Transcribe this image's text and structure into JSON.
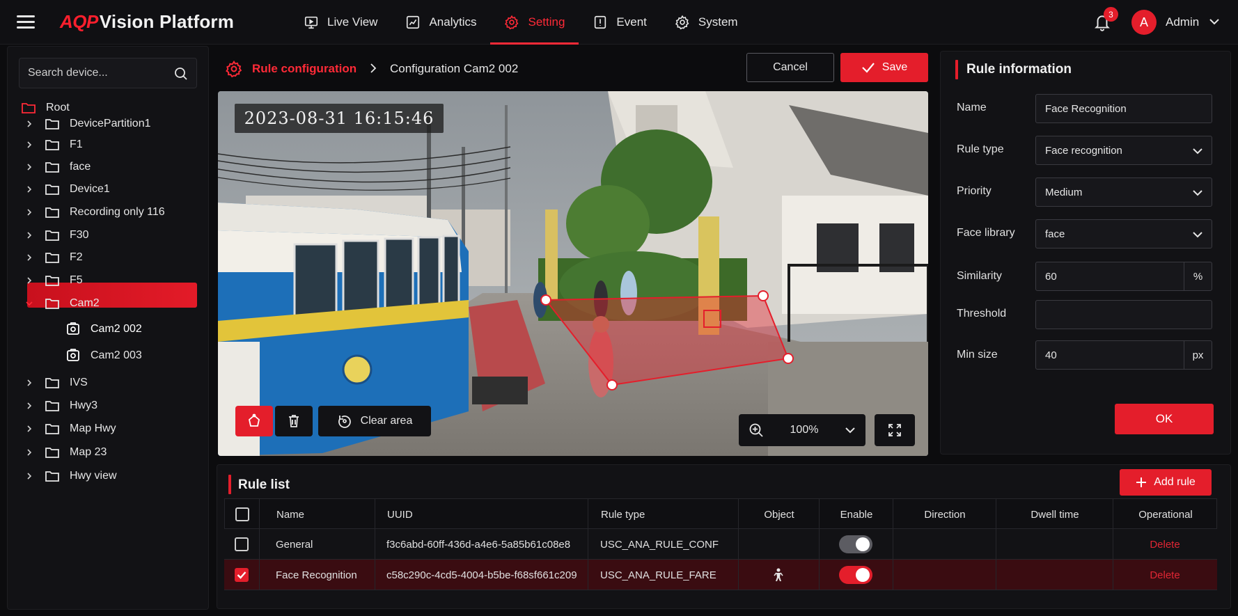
{
  "app": {
    "brand_part1": "AQP",
    "brand_part2": "Vision Platform"
  },
  "nav": [
    {
      "label": "Live View",
      "icon": "monitor-icon"
    },
    {
      "label": "Analytics",
      "icon": "analytics-icon"
    },
    {
      "label": "Setting",
      "icon": "gear-icon",
      "active": true
    },
    {
      "label": "Event",
      "icon": "event-icon"
    },
    {
      "label": "System",
      "icon": "system-gear-icon"
    }
  ],
  "header": {
    "notification_count": "3",
    "avatar_initial": "A",
    "user_name": "Admin"
  },
  "sidebar": {
    "search_placeholder": "Search device...",
    "root_label": "Root",
    "items": [
      {
        "label": "DevicePartition1",
        "type": "folder"
      },
      {
        "label": "F1",
        "type": "folder"
      },
      {
        "label": "face",
        "type": "folder"
      },
      {
        "label": "Device1",
        "type": "folder"
      },
      {
        "label": "Recording only 116",
        "type": "folder"
      },
      {
        "label": "F30",
        "type": "folder"
      },
      {
        "label": "F2",
        "type": "folder"
      },
      {
        "label": "F5",
        "type": "folder"
      },
      {
        "label": "Cam2",
        "type": "folder",
        "expanded": true
      },
      {
        "label": "Cam2 002",
        "type": "camera",
        "selected": true
      },
      {
        "label": "Cam2 003",
        "type": "camera"
      },
      {
        "label": "IVS",
        "type": "folder"
      },
      {
        "label": "Hwy3",
        "type": "folder"
      },
      {
        "label": "Map Hwy",
        "type": "folder"
      },
      {
        "label": "Map 23",
        "type": "folder"
      },
      {
        "label": "Hwy view",
        "type": "folder"
      }
    ]
  },
  "breadcrumb": {
    "title": "Rule configuration",
    "current": "Configuration Cam2 002"
  },
  "actions": {
    "cancel": "Cancel",
    "save": "Save"
  },
  "video": {
    "timestamp": "2023-08-31  16:15:46",
    "clear_area": "Clear area",
    "zoom": "100%"
  },
  "rule_info": {
    "title": "Rule information",
    "fields": {
      "name": {
        "label": "Name",
        "value": "Face Recognition"
      },
      "rule_type": {
        "label": "Rule type",
        "value": "Face recognition"
      },
      "priority": {
        "label": "Priority",
        "value": "Medium"
      },
      "face_library": {
        "label": "Face library",
        "value": "face"
      },
      "similarity": {
        "label": "Similarity",
        "value": "60",
        "unit": "%"
      },
      "threshold": {
        "label": "Threshold",
        "value": ""
      },
      "min_size": {
        "label": "Min size",
        "value": "40",
        "unit": "px"
      }
    },
    "ok": "OK"
  },
  "rule_list": {
    "title": "Rule list",
    "add_rule": "Add rule",
    "columns": [
      "Name",
      "UUID",
      "Rule type",
      "Object",
      "Enable",
      "Direction",
      "Dwell time",
      "Operational"
    ],
    "rows": [
      {
        "name": "General",
        "uuid": "f3c6abd-60ff-436d-a4e6-5a85b61c08e8",
        "rule_type": "USC_ANA_RULE_CONF",
        "object": "",
        "enabled": false,
        "direction": "",
        "dwell": "",
        "op": "Delete",
        "checked": false
      },
      {
        "name": "Face Recognition",
        "uuid": "c58c290c-4cd5-4004-b5be-f68sf661c209",
        "rule_type": "USC_ANA_RULE_FARE",
        "object": "person-icon",
        "enabled": true,
        "direction": "",
        "dwell": "",
        "op": "Delete",
        "checked": true
      }
    ]
  },
  "colors": {
    "accent": "#e41e2b",
    "background": "#0c0c0e",
    "panel": "#121215"
  }
}
